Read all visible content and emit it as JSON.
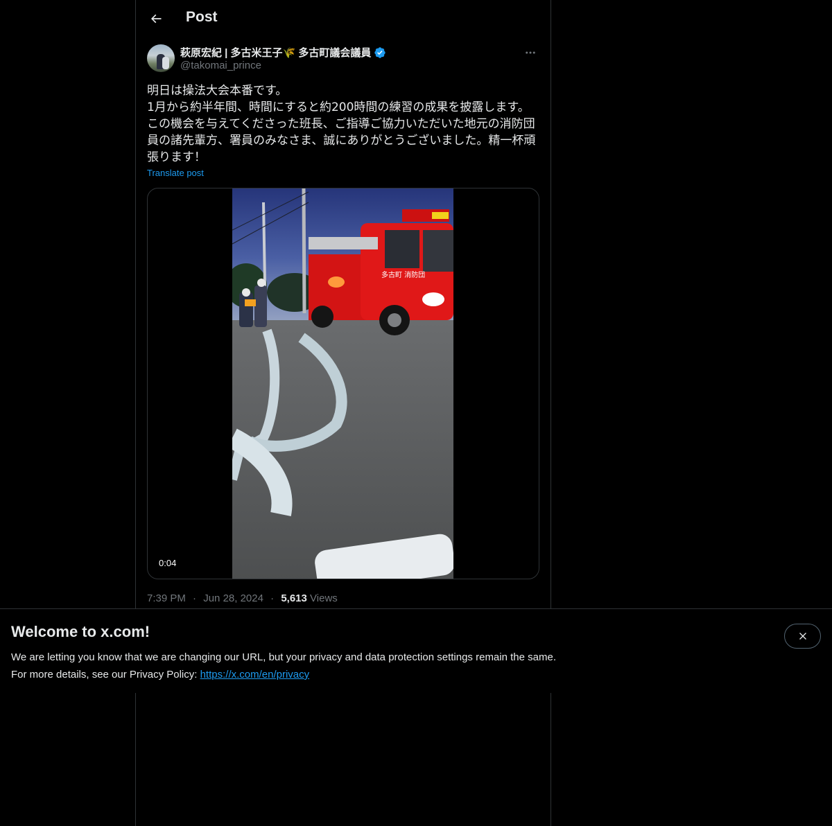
{
  "header": {
    "title": "Post",
    "back_icon": "arrow-left-icon"
  },
  "post": {
    "author": {
      "display_name": "萩原宏紀 | 多古米王子🌾 多古町議会議員",
      "handle": "@takomai_prince",
      "verified": true,
      "verified_color": "#1d9bf0"
    },
    "text": "明日は操法大会本番です。\n1月から約半年間、時間にすると約200時間の練習の成果を披露します。\nこの機会を与えてくださった班長、ご指導ご協力いただいた地元の消防団員の諸先輩方、署員のみなさま、誠にありがとうございました。精一杯頑張ります！",
    "translate_label": "Translate post",
    "media": {
      "type": "video",
      "duration": "0:04",
      "vehicle_label": "多古町 消防団"
    },
    "time": "7:39 PM",
    "date": "Jun 28, 2024",
    "views_count": "5,613",
    "views_label": "Views",
    "separator": "·"
  },
  "banner": {
    "title": "Welcome to x.com!",
    "line1": "We are letting you know that we are changing our URL, but your privacy and data protection settings remain the same.",
    "line2_prefix": "For more details, see our Privacy Policy: ",
    "link": "https://x.com/en/privacy",
    "close_icon": "close-icon"
  },
  "colors": {
    "background": "#000000",
    "text": "#e7e9ea",
    "secondary_text": "#71767b",
    "accent": "#1d9bf0",
    "border": "#2f3336"
  }
}
